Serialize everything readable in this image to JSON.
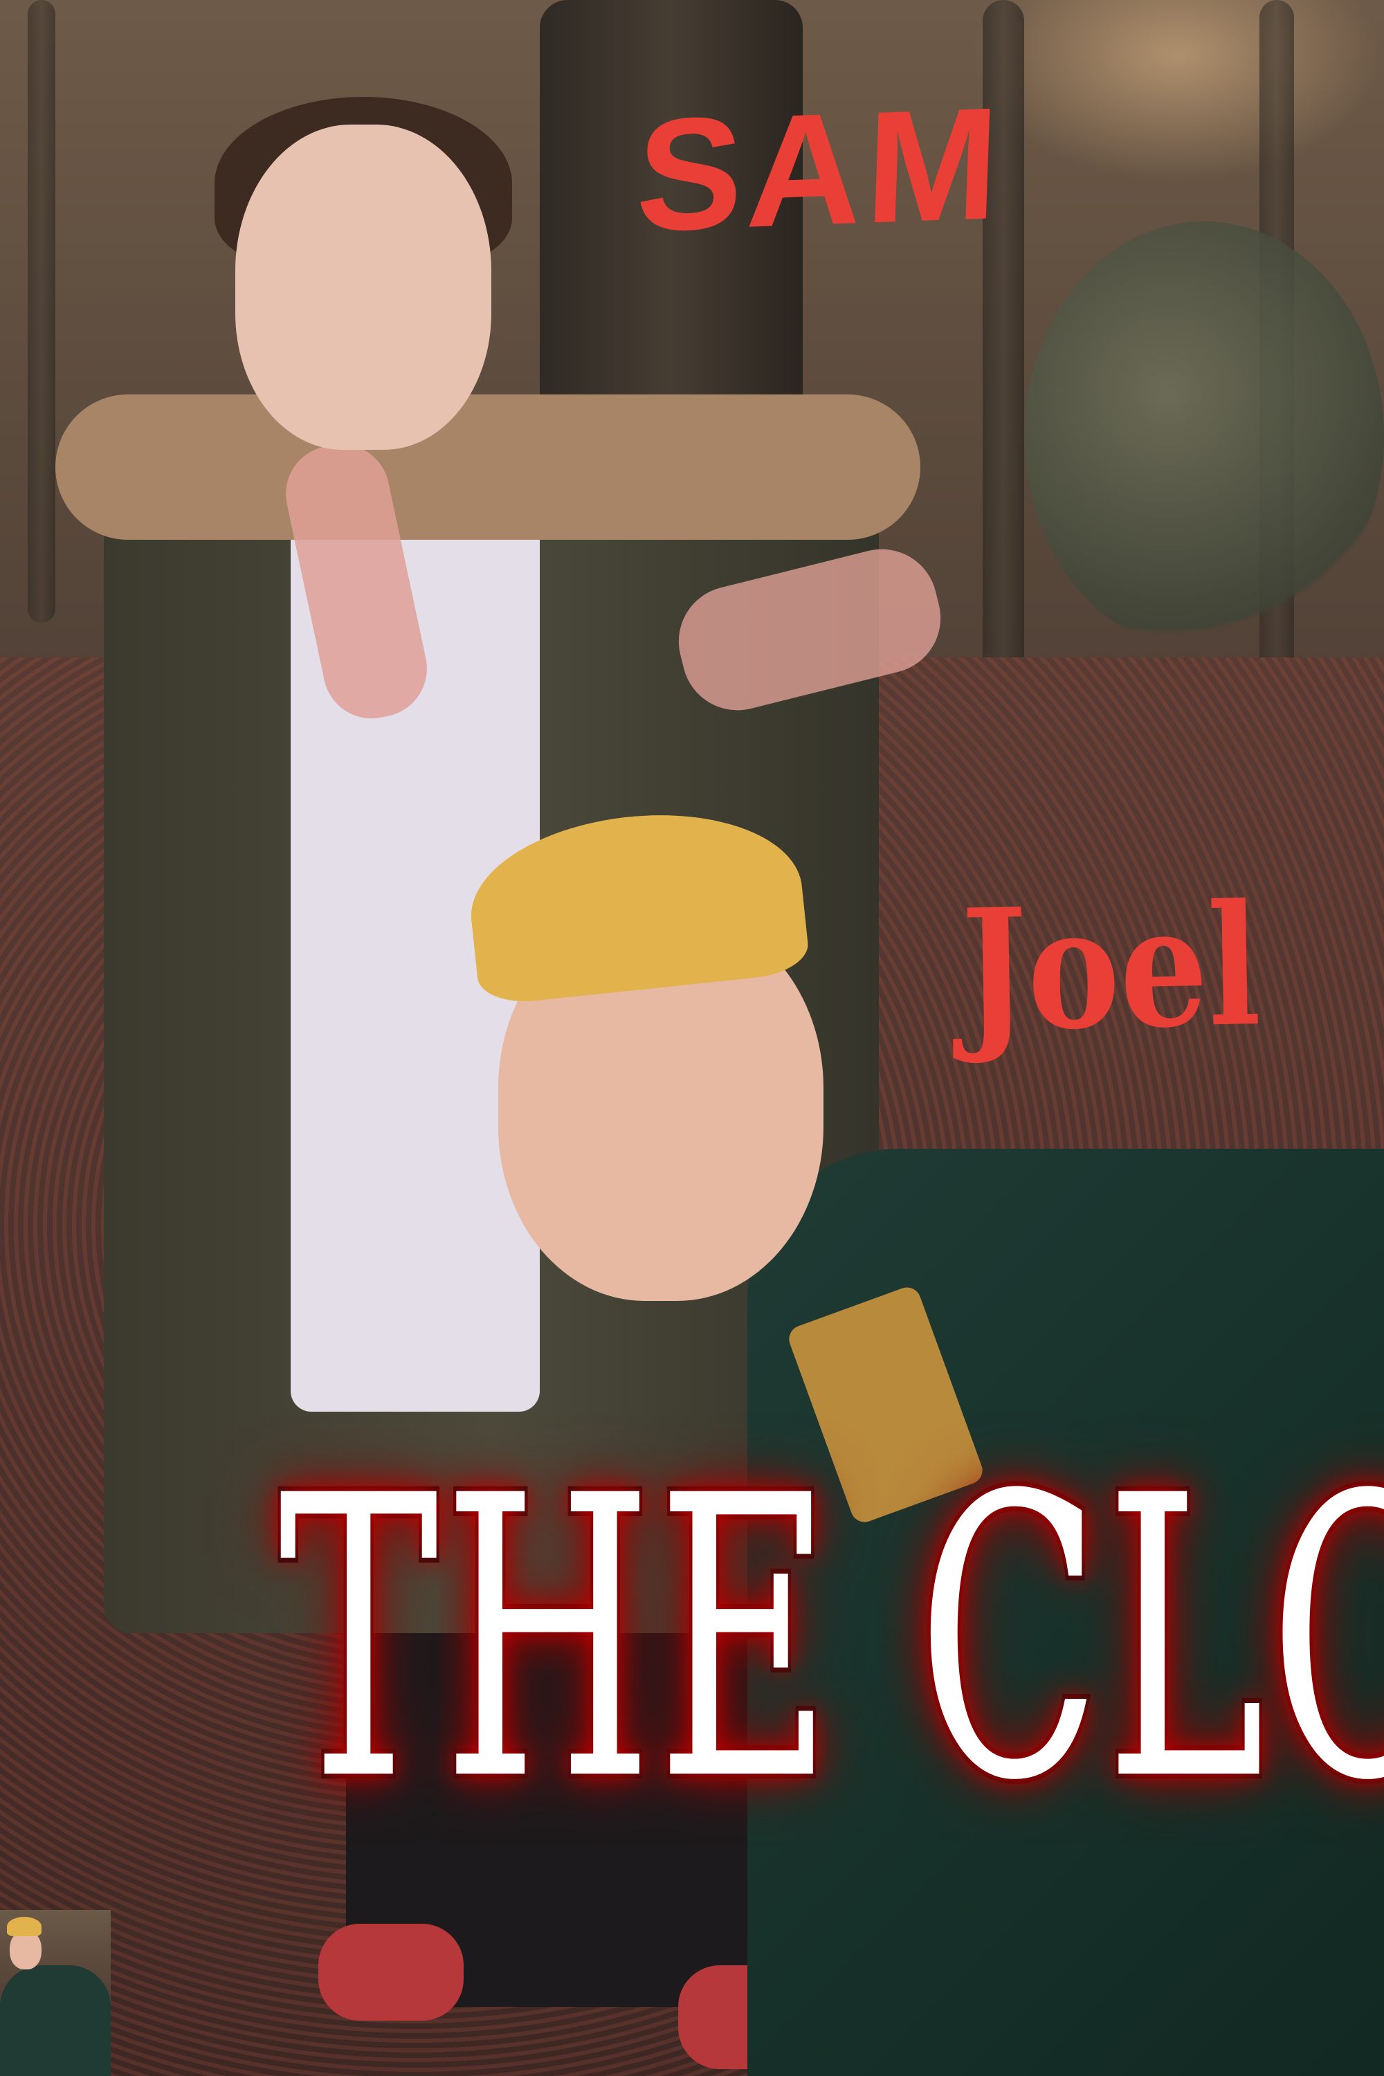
{
  "poster": {
    "title": "THE CLONES",
    "names": {
      "top": "SAM",
      "middle": "Joel"
    }
  },
  "colors": {
    "name_text": "#ea3f36",
    "title_text": "#ffffff",
    "title_glow": "#c00000"
  }
}
